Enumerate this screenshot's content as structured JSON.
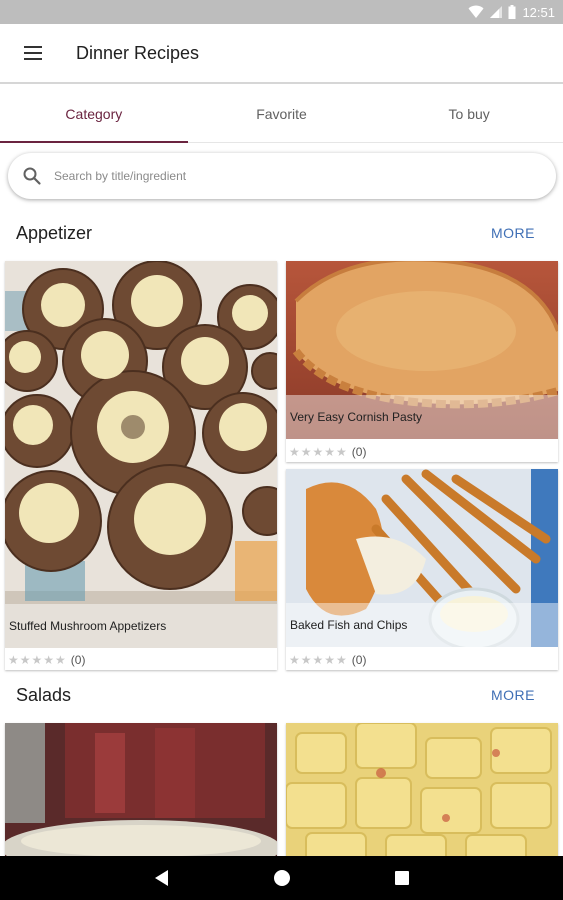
{
  "status_bar": {
    "time": "12:51"
  },
  "app_bar": {
    "title": "Dinner Recipes",
    "menu_icon": "hamburger-menu-icon"
  },
  "tabs": [
    {
      "label": "Category",
      "active": true
    },
    {
      "label": "Favorite",
      "active": false
    },
    {
      "label": "To buy",
      "active": false
    }
  ],
  "search": {
    "placeholder": "Search by title/ingredient",
    "value": ""
  },
  "sections": [
    {
      "title": "Appetizer",
      "more_label": "MORE",
      "recipes": [
        {
          "title": "Stuffed Mushroom Appetizers",
          "rating_count": "(0)",
          "stars": "★★★★★"
        },
        {
          "title": "Very Easy Cornish Pasty",
          "rating_count": "(0)",
          "stars": "★★★★★"
        },
        {
          "title": "Baked Fish and Chips",
          "rating_count": "(0)",
          "stars": "★★★★★"
        }
      ]
    },
    {
      "title": "Salads",
      "more_label": "MORE",
      "recipes": []
    }
  ],
  "colors": {
    "accent": "#6b2440",
    "link": "#3f6fb5",
    "status_bar": "#bdbdbd"
  }
}
